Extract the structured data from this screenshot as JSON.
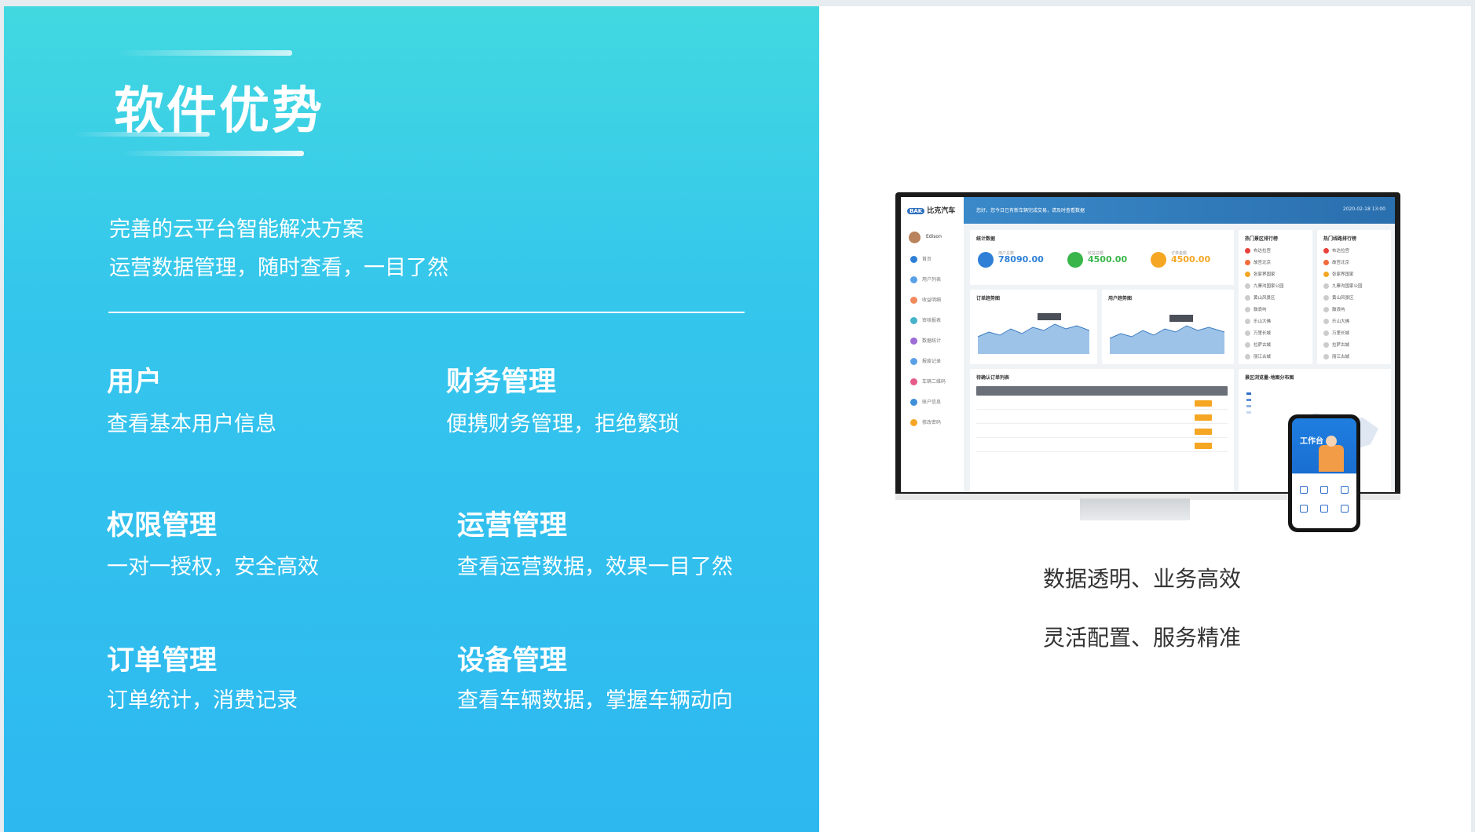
{
  "slide": {
    "title": "软件优势",
    "subtitle_lines": [
      "完善的云平台智能解决方案",
      "运营数据管理，随时查看，一目了然"
    ],
    "features": [
      {
        "heading": "用户",
        "desc": "查看基本用户信息"
      },
      {
        "heading": "财务管理",
        "desc": "便携财务管理，拒绝繁琐"
      },
      {
        "heading": "权限管理",
        "desc": "一对一授权，安全高效"
      },
      {
        "heading": "运营管理",
        "desc": "查看运营数据，效果一目了然"
      },
      {
        "heading": "订单管理",
        "desc": "订单统计，消费记录"
      },
      {
        "heading": "设备管理",
        "desc": "查看车辆数据，掌握车辆动向"
      }
    ],
    "taglines": [
      "数据透明、业务高效",
      "灵活配置、服务精准"
    ]
  },
  "mockup": {
    "brand": "比克汽车",
    "brand_badge": "BAK",
    "user_name": "Edison",
    "sidebar_items": [
      "首页",
      "用户列表",
      "收益明细",
      "审核报表",
      "数据统计",
      "报废记录",
      "车辆二维码",
      "账户信息",
      "修改密码"
    ],
    "notice": "您好，您今日已有新车辆完成交易，请及时查看数据",
    "time": "2020-02-18 13:00",
    "stats_title": "统计数据",
    "stats": [
      {
        "label": "用户总数",
        "value": "78090.00",
        "color": "#2f7fd6"
      },
      {
        "label": "收益总额",
        "value": "4500.00",
        "color": "#39b54a"
      },
      {
        "label": "订单金额",
        "value": "4500.00",
        "color": "#f5a623"
      }
    ],
    "chart1_title": "订单趋势图",
    "chart2_title": "用户趋势图",
    "rank1_title": "热门景区排行榜",
    "rank2_title": "热门线路排行榜",
    "rank_items": [
      "布达拉宫",
      "故宫北京",
      "张家界国家",
      "九寨沟国家公园",
      "黄山风景区",
      "鼓浪屿",
      "乐山大佛",
      "万里长城",
      "拉萨古城",
      "丽江古城"
    ],
    "table_title": "待确认订单列表",
    "map_title": "景区浏览量-地图分布图",
    "phone_title": "工作台"
  }
}
